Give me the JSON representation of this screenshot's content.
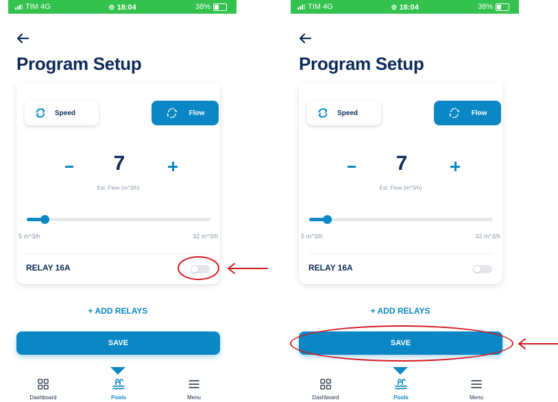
{
  "status_bar": {
    "carrier": "TIM 4G",
    "time": "18:04",
    "battery": "38%"
  },
  "page": {
    "title": "Program Setup"
  },
  "mode": {
    "speed_label": "Speed",
    "flow_label": "Flow",
    "selected": "Flow"
  },
  "flow": {
    "value": "7",
    "caption": "Est. Flow (m^3/h)"
  },
  "slider": {
    "min_label": "5 m^3/h",
    "max_label": "32 m^3/h",
    "fill_fraction": 0.1
  },
  "relay": {
    "label": "RELAY 16A",
    "enabled": false
  },
  "actions": {
    "add_relays_label": "+ ADD RELAYS",
    "save_label": "SAVE"
  },
  "nav": {
    "tabs": [
      {
        "label": "Dashboard",
        "icon": "grid-icon"
      },
      {
        "label": "Pools",
        "icon": "pool-icon",
        "active": true
      },
      {
        "label": "Menu",
        "icon": "hamburger-icon"
      }
    ]
  },
  "colors": {
    "accent": "#0a87c4",
    "navy": "#0d2a5a",
    "status_bar": "#32c24d",
    "annotation": "#d4181f"
  }
}
